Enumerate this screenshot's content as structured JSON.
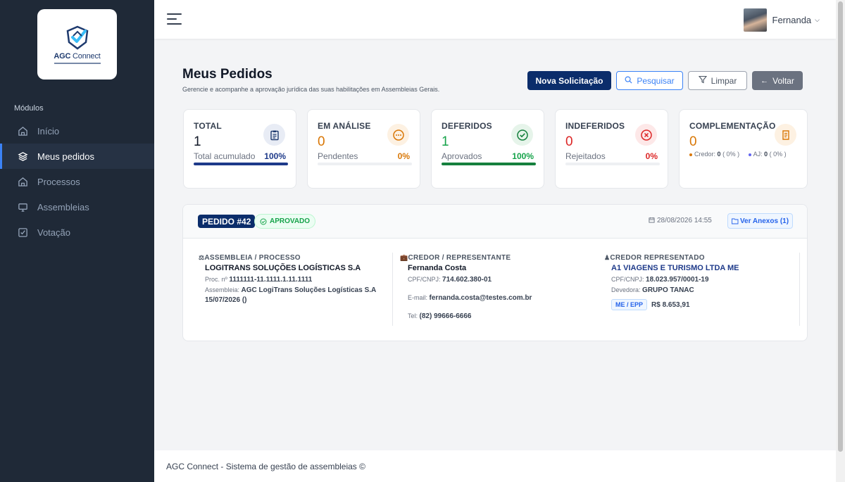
{
  "brand": {
    "name_bold": "AGC",
    "name_rest": " Connect"
  },
  "sidebar": {
    "section_label": "Módulos",
    "items": [
      {
        "label": "Início",
        "icon": "home-icon",
        "active": false
      },
      {
        "label": "Meus pedidos",
        "icon": "layers-icon",
        "active": true
      },
      {
        "label": "Processos",
        "icon": "home-icon",
        "active": false
      },
      {
        "label": "Assembleias",
        "icon": "monitor-icon",
        "active": false
      },
      {
        "label": "Votação",
        "icon": "check-square-icon",
        "active": false
      }
    ]
  },
  "topbar": {
    "user_name": "Fernanda"
  },
  "page": {
    "title": "Meus Pedidos",
    "subtitle": "Gerencie e acompanhe a aprovação jurídica das suas habilitações em Assembleias Gerais."
  },
  "actions": {
    "new_request": "Nova Solicitação",
    "search": "Pesquisar",
    "clear": "Limpar",
    "back": "Voltar"
  },
  "stats": {
    "total": {
      "title": "TOTAL",
      "value": "1",
      "label": "Total acumulado",
      "pct": "100%",
      "fill": 1.0,
      "color": "#1e3a8a"
    },
    "analysis": {
      "title": "EM ANÁLISE",
      "value": "0",
      "label": "Pendentes",
      "pct": "0%",
      "fill": 0.0,
      "color": "#d97706"
    },
    "approved": {
      "title": "DEFERIDOS",
      "value": "1",
      "label": "Aprovados",
      "pct": "100%",
      "fill": 1.0,
      "color": "#15803d"
    },
    "rejected": {
      "title": "INDEFERIDOS",
      "value": "0",
      "label": "Rejeitados",
      "pct": "0%",
      "fill": 0.0,
      "color": "#dc2626"
    },
    "complement": {
      "title": "COMPLEMENTAÇÃO",
      "value": "0",
      "color": "#d97706",
      "credor_label": "Credor:",
      "credor_value": "0",
      "credor_pct": "( 0% )",
      "aj_label": "AJ:",
      "aj_value": "0",
      "aj_pct": "( 0% )"
    }
  },
  "order": {
    "number": "PEDIDO #42",
    "status": "APROVADO",
    "date": "28/08/2026 14:55",
    "annex_button": "Ver Anexos (1)",
    "assembly": {
      "title": "ASSEMBLEIA / PROCESSO",
      "company": "LOGITRANS SOLUÇÕES LOGÍSTICAS S.A",
      "proc_label": "Proc. nº",
      "proc_value": "1111111-11.1111.1.11.1111",
      "assembly_label": "Assembleia:",
      "assembly_value": "AGC LogiTrans Soluções Logísticas S.A",
      "assembly_date": "15/07/2026 ()"
    },
    "representative": {
      "title": "CREDOR / REPRESENTANTE",
      "name": "Fernanda Costa",
      "doc_label": "CPF/CNPJ:",
      "doc_value": "714.602.380-01",
      "email_label": "E-mail:",
      "email_value": "fernanda.costa@testes.com.br",
      "phone_label": "Tel:",
      "phone_value": "(82) 99666-6666"
    },
    "creditor": {
      "title": "CREDOR REPRESENTADO",
      "name": "A1 VIAGENS E TURISMO LTDA ME",
      "doc_label": "CPF/CNPJ:",
      "doc_value": "18.023.957/0001-19",
      "debtor_label": "Devedora:",
      "debtor_value": "GRUPO TANAC",
      "tag": "ME / EPP",
      "amount": "R$ 8.653,91"
    }
  },
  "footer": {
    "text": "AGC Connect - Sistema de gestão de assembleias ©"
  }
}
